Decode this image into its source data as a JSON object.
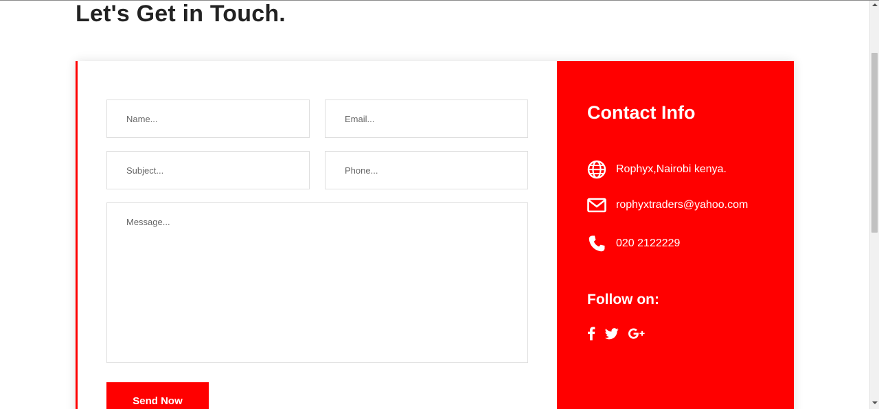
{
  "page": {
    "heading": "Let's Get in Touch."
  },
  "form": {
    "name_placeholder": "Name...",
    "email_placeholder": "Email...",
    "subject_placeholder": "Subject...",
    "phone_placeholder": "Phone...",
    "message_placeholder": "Message...",
    "send_label": "Send Now"
  },
  "contact": {
    "title": "Contact Info",
    "address": "Rophyx,Nairobi kenya.",
    "email": "rophyxtraders@yahoo.com",
    "phone": "020 2122229",
    "address_icon": "globe-icon",
    "email_icon": "envelope-icon",
    "phone_icon": "phone-icon"
  },
  "social": {
    "title": "Follow on:",
    "links": [
      "facebook-icon",
      "twitter-icon",
      "google-plus-icon"
    ]
  },
  "colors": {
    "accent": "#ff0000",
    "heading": "#222222",
    "panel_text": "#ffffff"
  }
}
